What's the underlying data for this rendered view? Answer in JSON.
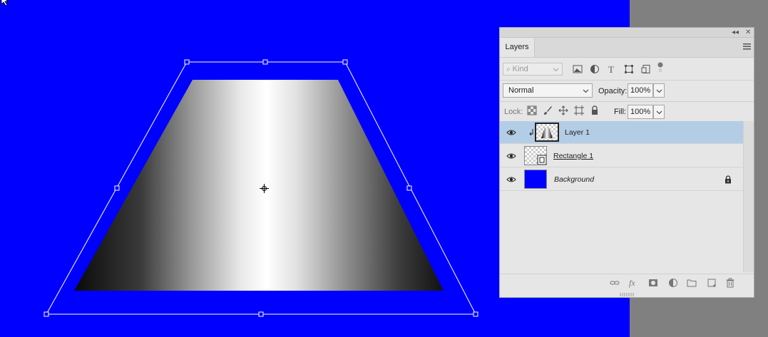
{
  "panel": {
    "tab_label": "Layers",
    "kind_placeholder": "Kind",
    "blend_mode": "Normal",
    "opacity_label": "Opacity:",
    "opacity_value": "100%",
    "lock_label": "Lock:",
    "fill_label": "Fill:",
    "fill_value": "100%"
  },
  "layers": [
    {
      "name": "Layer 1",
      "selected": true,
      "thumb": "gradient-clipped"
    },
    {
      "name": "Rectangle 1",
      "selected": false,
      "thumb": "shape"
    },
    {
      "name": "Background",
      "selected": false,
      "thumb": "blue-fill",
      "locked": true
    }
  ],
  "colors": {
    "canvas_bg": "#0000ff",
    "pasteboard": "#808080",
    "selected_row": "#b4cde6",
    "panel_bg": "#e6e6e6"
  }
}
